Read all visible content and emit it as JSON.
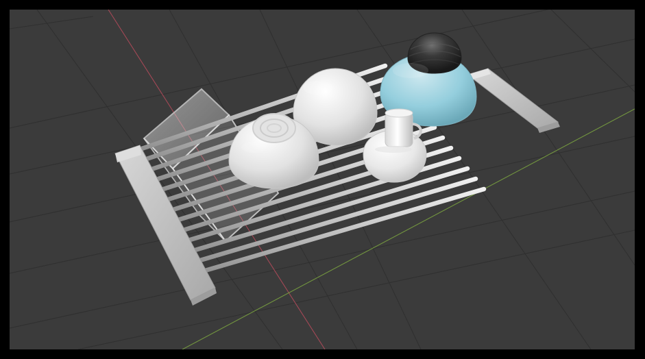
{
  "app": {
    "kind": "3d-viewport"
  },
  "viewport": {
    "background_color": "#3b3b3b",
    "grid_color": "#2d2d2d",
    "x_axis_color": "#b74b5b",
    "y_axis_color": "#79a040",
    "frame_color": "#000000"
  },
  "scene": {
    "objects": [
      "dish-rack",
      "clear-container",
      "bowl-left",
      "bowl-middle",
      "cup-with-saucer",
      "blue-bowl",
      "dark-bowl"
    ]
  }
}
